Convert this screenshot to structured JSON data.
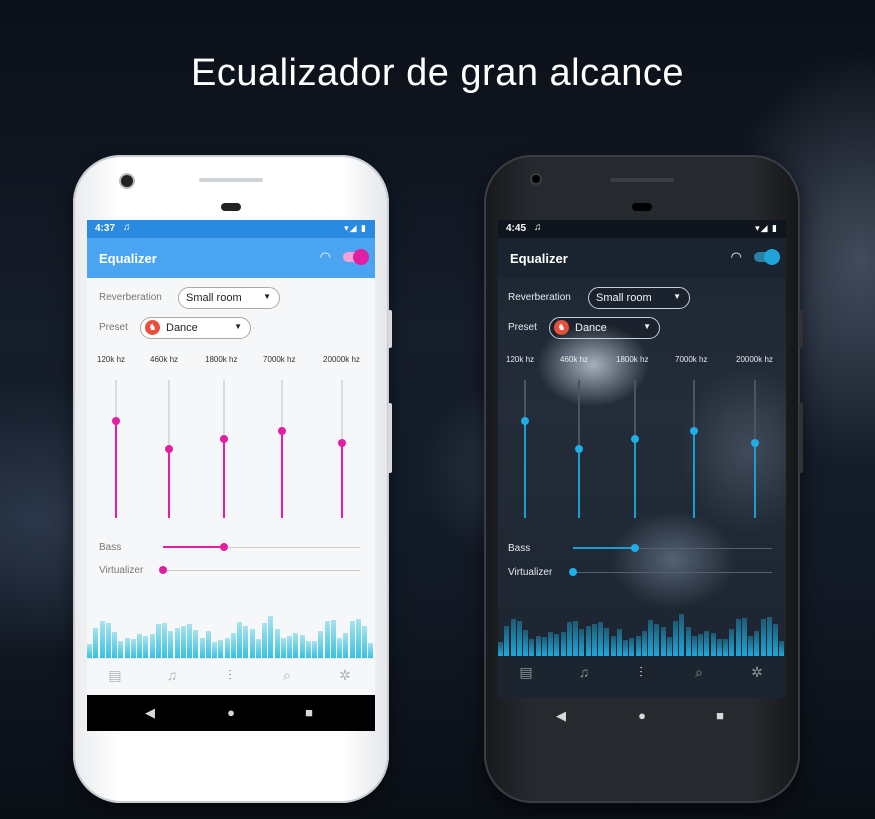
{
  "headline": "Ecualizador de gran alcance",
  "light": {
    "status": {
      "time": "4:37",
      "note_icon": "♫",
      "signal": "▾◢ ▮"
    },
    "appbar": {
      "title": "Equalizer",
      "gauge_icon": "◠"
    },
    "reverb": {
      "label": "Reverberation",
      "value": "Small room"
    },
    "preset": {
      "label": "Preset",
      "value": "Dance",
      "icon": "♞"
    },
    "bands": [
      {
        "label": "120k hz",
        "level": 0.7
      },
      {
        "label": "460k hz",
        "level": 0.5
      },
      {
        "label": "1800k hz",
        "level": 0.57
      },
      {
        "label": "7000k hz",
        "level": 0.63
      },
      {
        "label": "20000k hz",
        "level": 0.54
      }
    ],
    "bass": {
      "label": "Bass",
      "level": 0.31
    },
    "virtualizer": {
      "label": "Virtualizer",
      "level": 0.0
    },
    "nav": {
      "library": "▤",
      "songs": "♫",
      "equalizer": "⫶",
      "search": "⌕",
      "settings": "✲"
    },
    "system": {
      "back": "◀",
      "home": "●",
      "recents": "■"
    }
  },
  "dark": {
    "status": {
      "time": "4:45",
      "note_icon": "♫",
      "signal": "▾◢ ▮"
    },
    "appbar": {
      "title": "Equalizer",
      "gauge_icon": "◠"
    },
    "reverb": {
      "label": "Reverberation",
      "value": "Small room"
    },
    "preset": {
      "label": "Preset",
      "value": "Dance",
      "icon": "♞"
    },
    "bands": [
      {
        "label": "120k hz",
        "level": 0.7
      },
      {
        "label": "460k hz",
        "level": 0.5
      },
      {
        "label": "1800k hz",
        "level": 0.57
      },
      {
        "label": "7000k hz",
        "level": 0.63
      },
      {
        "label": "20000k hz",
        "level": 0.54
      }
    ],
    "bass": {
      "label": "Bass",
      "level": 0.31
    },
    "virtualizer": {
      "label": "Virtualizer",
      "level": 0.0
    },
    "nav": {
      "library": "▤",
      "songs": "♫",
      "equalizer": "⫶",
      "search": "⌕",
      "settings": "✲"
    },
    "system": {
      "back": "◀",
      "home": "●",
      "recents": "■"
    }
  },
  "colors": {
    "light_accent": "#e21fa3",
    "light_appbar": "#4aa4f2",
    "dark_accent": "#1c9fd0",
    "viz_light": "#36c2e0",
    "viz_dark": "#1fa9d8"
  }
}
